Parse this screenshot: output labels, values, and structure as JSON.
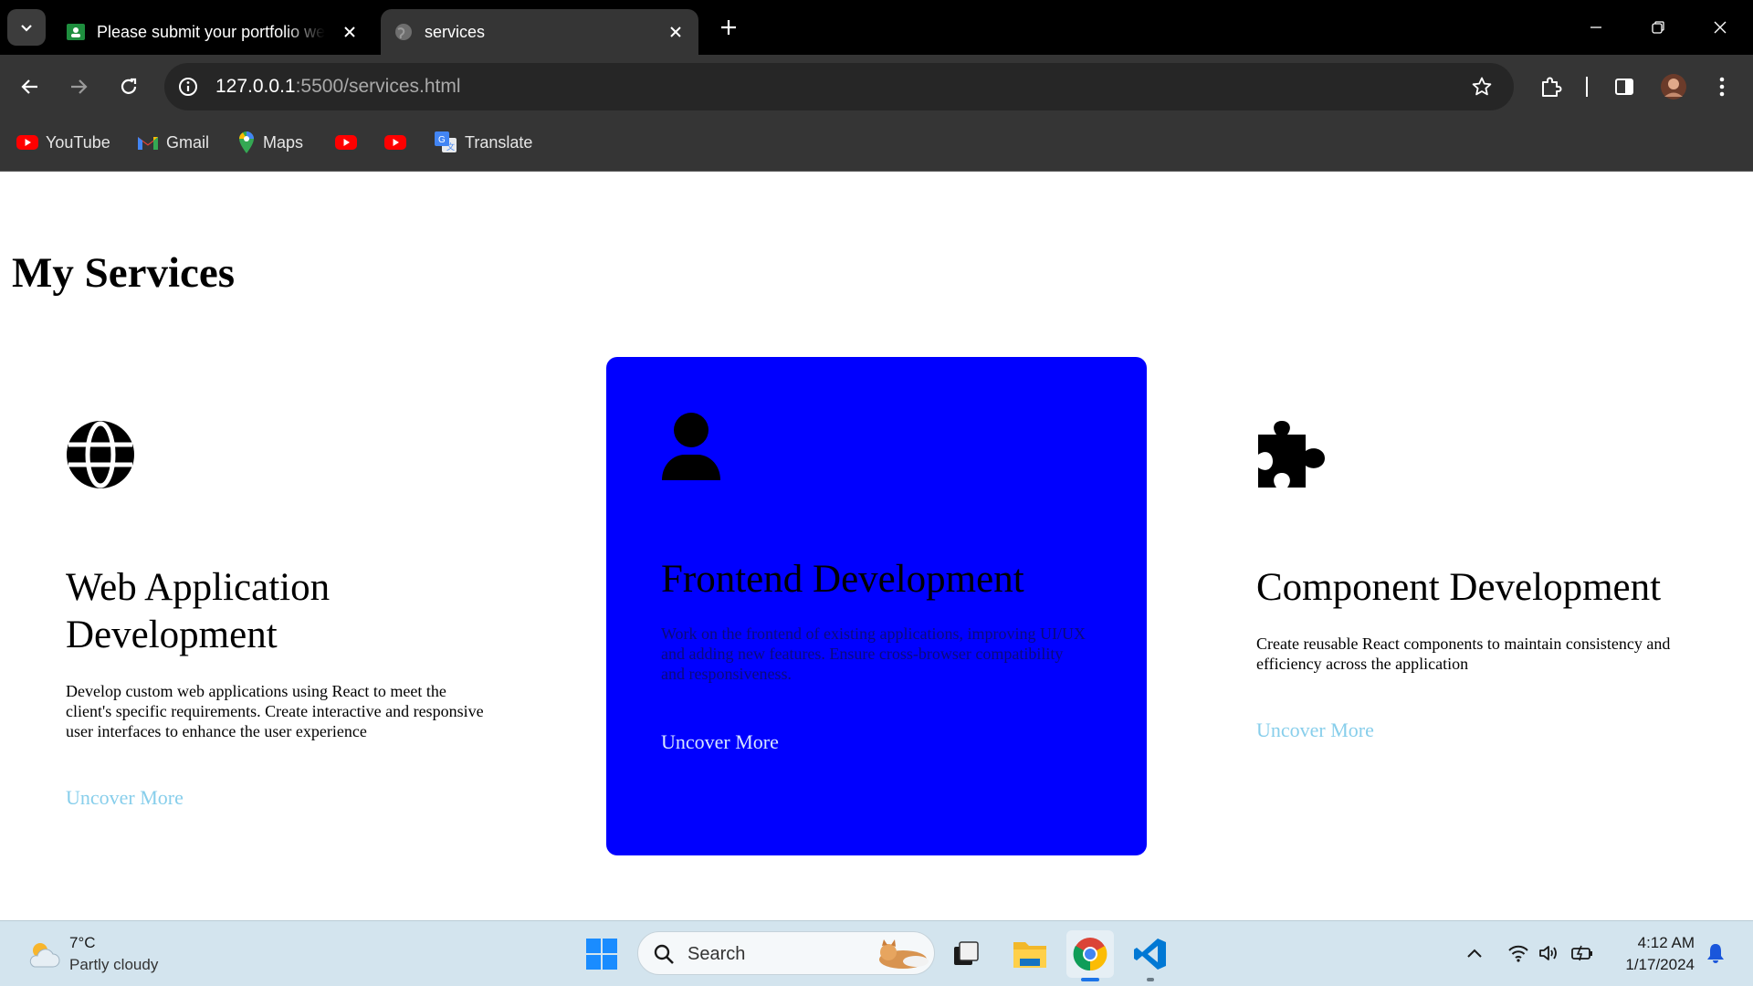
{
  "browser": {
    "tabs": [
      {
        "title": "Please submit your portfolio website",
        "favicon": "google-classroom-icon",
        "active": false
      },
      {
        "title": "services",
        "favicon": "globe-icon",
        "active": true
      }
    ],
    "url_host": "127.0.0.1",
    "url_path": ":5500/services.html",
    "bookmarks": [
      {
        "label": "YouTube",
        "icon": "youtube-icon"
      },
      {
        "label": "Gmail",
        "icon": "gmail-icon"
      },
      {
        "label": "Maps",
        "icon": "maps-icon"
      },
      {
        "label": "",
        "icon": "youtube-icon"
      },
      {
        "label": "",
        "icon": "youtube-icon"
      },
      {
        "label": "Translate",
        "icon": "translate-icon"
      }
    ]
  },
  "page": {
    "title": "My Services",
    "cards": [
      {
        "icon": "globe-icon",
        "title": "Web Application Development",
        "description": "Develop custom web applications using React to meet the client's specific requirements. Create interactive and responsive user interfaces to enhance the user experience",
        "link": "Uncover More",
        "highlighted": false
      },
      {
        "icon": "user-icon",
        "title": "Frontend Development",
        "description": "Work on the frontend of existing applications, improving UI/UX and adding new features. Ensure cross-browser compatibility and responsiveness.",
        "link": "Uncover More",
        "highlighted": true
      },
      {
        "icon": "puzzle-piece-icon",
        "title": "Component Development",
        "description": "Create reusable React components to maintain consistency and efficiency across the application",
        "link": "Uncover More",
        "highlighted": false
      }
    ]
  },
  "taskbar": {
    "weather_temp": "7°C",
    "weather_desc": "Partly cloudy",
    "search_label": "Search",
    "time": "4:12 AM",
    "date": "1/17/2024"
  },
  "colors": {
    "highlight_card": "#0000ff",
    "link": "#87ceeb",
    "chrome_bg": "#353535"
  }
}
